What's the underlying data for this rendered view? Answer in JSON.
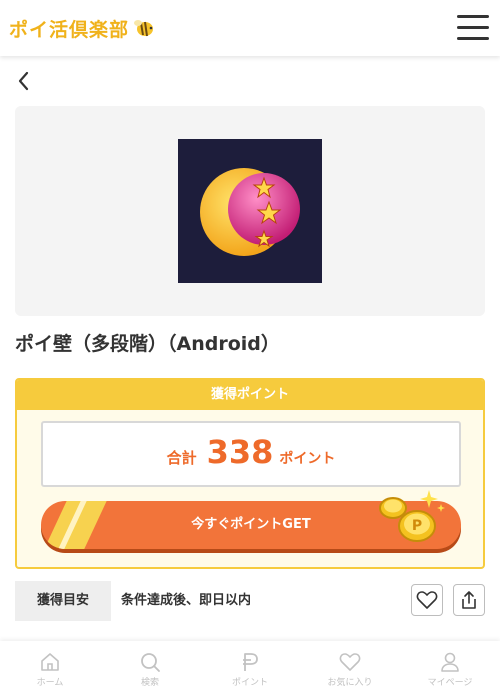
{
  "header": {
    "logo_text": "ポイ活倶楽部",
    "logo_icon": "bee-icon",
    "menu_icon": "hamburger-menu-icon"
  },
  "nav": {
    "back_icon": "chevron-left-icon"
  },
  "campaign": {
    "image_icon": "moon-stars-app-icon",
    "title": "ポイ壁（多段階）（Android）"
  },
  "points": {
    "header": "獲得ポイント",
    "total_label": "合計",
    "total_value": "338",
    "unit": "ポイント",
    "cta_label": "今すぐポイントGET"
  },
  "info": {
    "tag": "獲得目安",
    "text": "条件達成後、即日以内",
    "favorite_icon": "heart-icon",
    "share_icon": "share-icon"
  },
  "bottom_nav": [
    {
      "label": "ホーム",
      "icon": "home-icon"
    },
    {
      "label": "検索",
      "icon": "search-icon"
    },
    {
      "label": "ポイント",
      "icon": "points-p-icon"
    },
    {
      "label": "お気に入り",
      "icon": "heart-icon"
    },
    {
      "label": "マイページ",
      "icon": "user-icon"
    }
  ],
  "colors": {
    "brand_yellow": "#f6cb3d",
    "accent_orange": "#ee6a2a",
    "cta_orange": "#f2743a",
    "app_bg": "#1d1d3b"
  }
}
